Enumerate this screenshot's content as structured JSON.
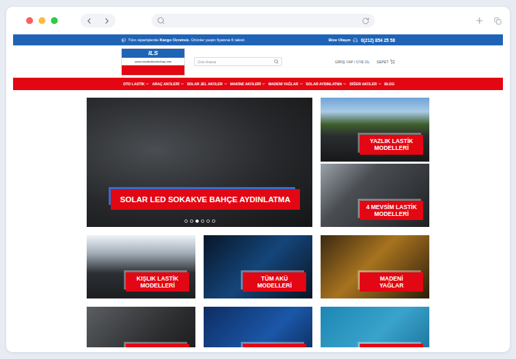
{
  "topbar": {
    "notice": [
      {
        "text": "Tüm siparişlerde ",
        "bold": false
      },
      {
        "text": "Kargo Ücretsiz.",
        "bold": true
      },
      {
        "text": " Ürünler peşin fiyatına 6 taksit",
        "bold": false
      }
    ],
    "contact": "Bize Ulaşın",
    "phone": "0(212) 854 25 58"
  },
  "logo": {
    "name": "ILS",
    "site": "www.istanbullastikshop.com"
  },
  "search": {
    "placeholder": "Ürün Arama"
  },
  "account": {
    "login": "GİRİŞ YAP / ÜYE OL",
    "cart": "SEPET"
  },
  "nav": [
    {
      "label": "OTO LASTİK",
      "dropdown": true
    },
    {
      "label": "ARAÇ AKÜLERİ",
      "dropdown": true
    },
    {
      "label": "SOLAR JEL AKÜLER",
      "dropdown": true
    },
    {
      "label": "MAKİNE AKÜLERİ",
      "dropdown": true
    },
    {
      "label": "MADENİ YAĞLAR",
      "dropdown": true
    },
    {
      "label": "SOLAR AYDINLATMA",
      "dropdown": true
    },
    {
      "label": "DİĞER AKÜLER",
      "dropdown": true
    },
    {
      "label": "BLOG",
      "dropdown": false
    }
  ],
  "slider": {
    "title": [
      "SOLAR LED SOKAK",
      "VE BAHÇE AYDINLATMA"
    ],
    "dots": [
      {
        "selected": false
      },
      {
        "selected": false
      },
      {
        "selected": true
      },
      {
        "selected": false
      },
      {
        "selected": false
      },
      {
        "selected": false
      }
    ]
  },
  "side_banners": [
    {
      "title": [
        "YAZLIK LASTİK",
        "MODELLERİ"
      ]
    },
    {
      "title": [
        "4 MEVSİM LASTİK",
        "MODELLERİ"
      ]
    }
  ],
  "banners": [
    {
      "title": [
        "KIŞLIK LASTİK",
        "MODELLERİ"
      ]
    },
    {
      "title": [
        "TÜM AKÜ",
        "MODELLERİ"
      ]
    },
    {
      "title": [
        "MADENİ",
        "YAĞLAR"
      ]
    },
    {
      "title": []
    },
    {
      "title": []
    },
    {
      "title": []
    }
  ]
}
